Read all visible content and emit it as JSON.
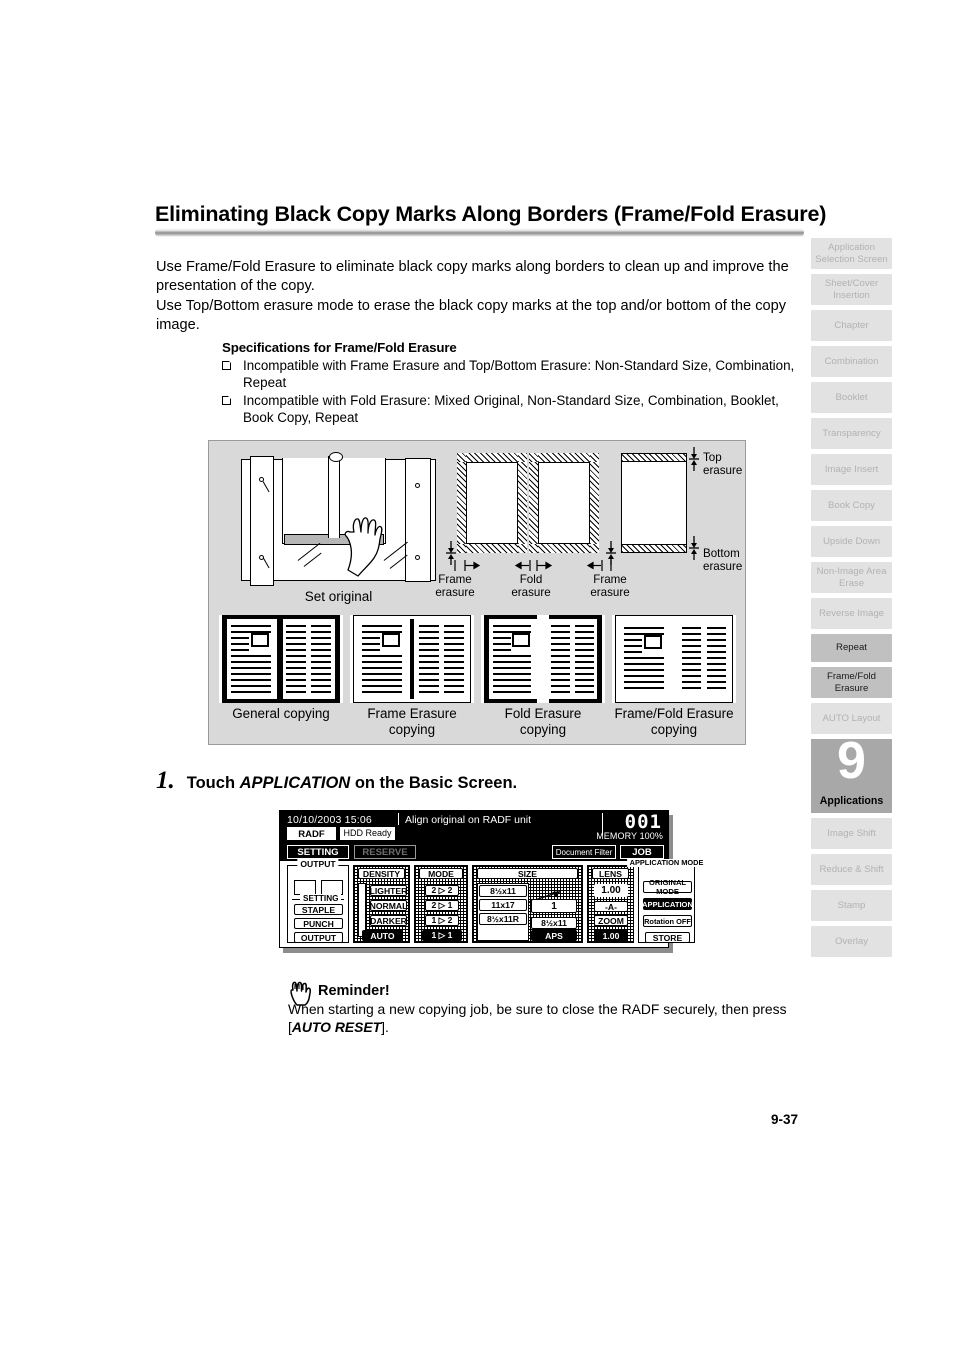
{
  "page": {
    "title": "Eliminating Black Copy Marks Along Borders (Frame/Fold Erasure)",
    "intro_line1": "Use Frame/Fold Erasure to eliminate black copy marks along borders to clean up and improve the presentation of the copy.",
    "intro_line2": "Use Top/Bottom erasure mode to erase the black copy marks at the top and/or bottom of the copy image.",
    "page_number": "9-37"
  },
  "spec": {
    "heading": "Specifications for Frame/Fold Erasure",
    "items": [
      "Incompatible with Frame Erasure and Top/Bottom Erasure: Non-Standard Size, Combination, Repeat",
      "Incompatible with Fold Erasure: Mixed Original, Non-Standard Size, Combination, Booklet, Book Copy, Repeat"
    ]
  },
  "diagram": {
    "set_original_caption": "Set original",
    "labels": {
      "frame_erasure_left": "Frame\nerasure",
      "fold_erasure": "Fold\nerasure",
      "frame_erasure_right": "Frame\nerasure",
      "top_erasure": "Top\nerasure",
      "bottom_erasure": "Bottom\nerasure"
    },
    "examples": [
      {
        "caption": "General copying"
      },
      {
        "caption": "Frame Erasure\ncopying"
      },
      {
        "caption": "Fold Erasure\ncopying"
      },
      {
        "caption": "Frame/Fold Erasure\ncopying"
      }
    ]
  },
  "step1": {
    "number": "1.",
    "text_before": "Touch ",
    "text_emphasis": "APPLICATION",
    "text_after": " on the Basic Screen."
  },
  "lcd": {
    "datetime": "10/10/2003 15:06",
    "message": "Align original on RADF unit",
    "counter": "001",
    "memory": "MEMORY 100%",
    "radf_label": "RADF",
    "hdd_label": "HDD Ready",
    "tabs": {
      "setting": "SETTING",
      "reserve": "RESERVE",
      "document_filter": "Document Filter",
      "job_list": "JOB LIST"
    },
    "output_panel": {
      "legend": "OUTPUT"
    },
    "setting_panel": {
      "legend": "SETTING",
      "keys": [
        "STAPLE",
        "PUNCH",
        "OUTPUT"
      ]
    },
    "density_panel": {
      "legend": "DENSITY",
      "keys": [
        "LIGHTER",
        "NORMAL",
        "DARKER"
      ],
      "bottom_key": "AUTO"
    },
    "mode_panel": {
      "legend": "MODE",
      "keys": [
        "2 ▷ 2",
        "2 ▷ 1",
        "1 ▷ 2"
      ],
      "bottom_key": "1 ▷ 1"
    },
    "size_panel": {
      "legend": "SIZE",
      "keys": [
        "8½x11",
        "11x17",
        "8½x11R"
      ],
      "output_key": "8½x11",
      "bottom_key": "APS"
    },
    "lens_panel": {
      "legend": "LENS",
      "value": "1.00",
      "keys": [
        "-A-",
        "ZOOM"
      ],
      "bottom_key": "1.00"
    },
    "application_panel": {
      "legend": "APPLICATION MODE",
      "keys": [
        "ORIGINAL MODE",
        "APPLICATION",
        "Rotation OFF"
      ],
      "bottom_key": "STORE"
    }
  },
  "reminder": {
    "heading": "Reminder!",
    "body_before": "When starting a new copying job, be sure to close the RADF securely, then press [",
    "body_emphasis": "AUTO RESET",
    "body_after": "]."
  },
  "sidebar": {
    "items": [
      {
        "label": "Application Selection Screen",
        "state": "dim"
      },
      {
        "label": "Sheet/Cover Insertion",
        "state": "dim"
      },
      {
        "label": "Chapter",
        "state": "dim"
      },
      {
        "label": "Combination",
        "state": "dim"
      },
      {
        "label": "Booklet",
        "state": "dim"
      },
      {
        "label": "Transparency",
        "state": "dim"
      },
      {
        "label": "Image Insert",
        "state": "dim"
      },
      {
        "label": "Book Copy",
        "state": "dim"
      },
      {
        "label": "Upside Down",
        "state": "dim"
      },
      {
        "label": "Non-Image Area Erase",
        "state": "dim"
      },
      {
        "label": "Reverse Image",
        "state": "dim"
      },
      {
        "label": "Repeat",
        "state": "mid"
      },
      {
        "label": "Frame/Fold Erasure",
        "state": "mid"
      },
      {
        "label": "AUTO Layout",
        "state": "dim"
      }
    ],
    "current": {
      "number": "9",
      "label": "Applications"
    },
    "items_after": [
      {
        "label": "Image Shift",
        "state": "dim"
      },
      {
        "label": "Reduce & Shift",
        "state": "dim"
      },
      {
        "label": "Stamp",
        "state": "dim"
      },
      {
        "label": "Overlay",
        "state": "dim"
      }
    ]
  }
}
